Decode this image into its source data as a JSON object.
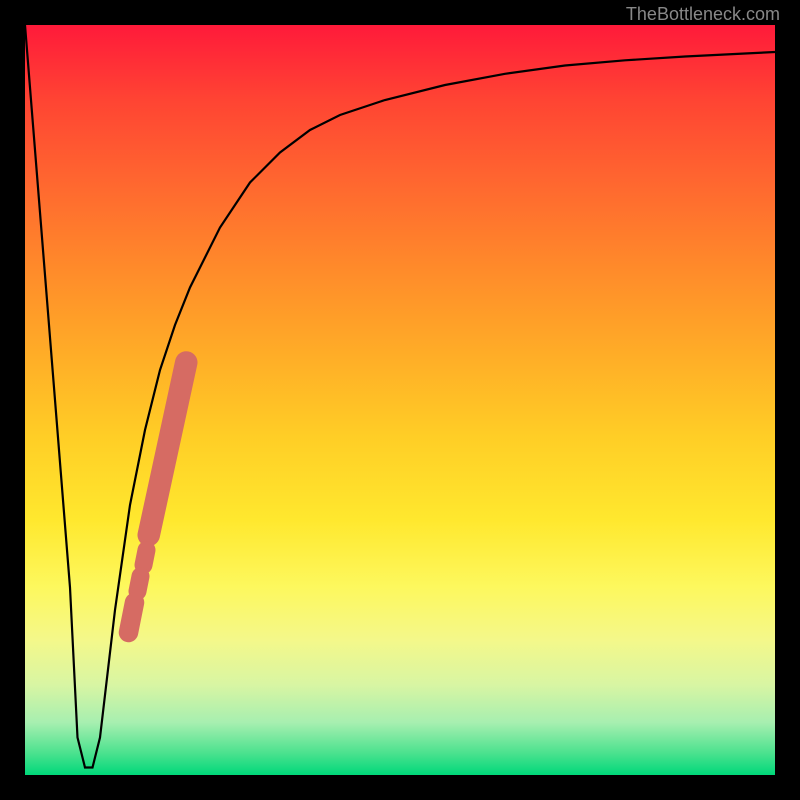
{
  "watermark": "TheBottleneck.com",
  "chart_data": {
    "type": "line",
    "title": "",
    "xlabel": "",
    "ylabel": "",
    "xlim": [
      0,
      100
    ],
    "ylim": [
      0,
      100
    ],
    "grid": false,
    "legend": false,
    "series": [
      {
        "name": "bottleneck-curve",
        "x": [
          0,
          2,
          4,
          6,
          7,
          8,
          9,
          10,
          12,
          14,
          16,
          18,
          20,
          22,
          24,
          26,
          28,
          30,
          34,
          38,
          42,
          48,
          56,
          64,
          72,
          80,
          88,
          96,
          100
        ],
        "y": [
          100,
          75,
          50,
          25,
          5,
          1,
          1,
          5,
          22,
          36,
          46,
          54,
          60,
          65,
          69,
          73,
          76,
          79,
          83,
          86,
          88,
          90,
          92,
          93.5,
          94.6,
          95.3,
          95.8,
          96.2,
          96.4
        ]
      }
    ],
    "highlight_band": {
      "name": "selected-range",
      "color": "#d66b63",
      "segments": [
        {
          "x_start": 16.5,
          "y_start": 32,
          "x_end": 21.5,
          "y_end": 55,
          "width": 3.0
        },
        {
          "x_start": 15.8,
          "y_start": 28,
          "x_end": 16.2,
          "y_end": 30,
          "width": 2.4
        },
        {
          "x_start": 15.0,
          "y_start": 24.5,
          "x_end": 15.4,
          "y_end": 26.5,
          "width": 2.4
        },
        {
          "x_start": 13.8,
          "y_start": 19,
          "x_end": 14.6,
          "y_end": 23,
          "width": 2.6
        }
      ]
    },
    "gradient_stops": [
      {
        "pos": 0,
        "color": "#ff1a3a"
      },
      {
        "pos": 50,
        "color": "#ffce26"
      },
      {
        "pos": 82,
        "color": "#f4f88a"
      },
      {
        "pos": 100,
        "color": "#00d87a"
      }
    ]
  }
}
